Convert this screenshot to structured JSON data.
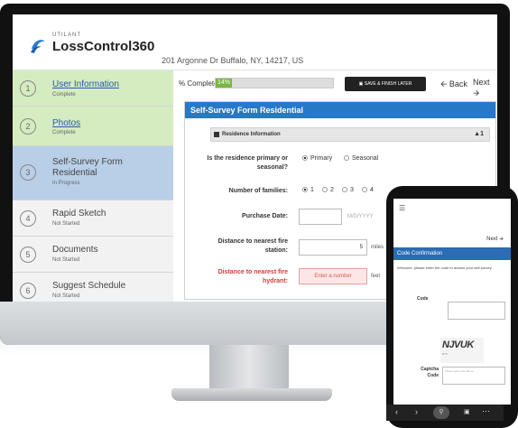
{
  "brand": {
    "small": "UTILANT",
    "name": "LossControl360",
    "accent": "#2b7bd6"
  },
  "address": "201 Argonne Dr Buffalo, NY, 14217, US",
  "steps": [
    {
      "num": "1",
      "label": "User Information",
      "status": "Complete",
      "state": "complete"
    },
    {
      "num": "2",
      "label": "Photos",
      "status": "Complete",
      "state": "complete"
    },
    {
      "num": "3",
      "label": "Self-Survey Form Residential",
      "status": "In Progress",
      "state": "active"
    },
    {
      "num": "4",
      "label": "Rapid Sketch",
      "status": "Not Started",
      "state": "pending"
    },
    {
      "num": "5",
      "label": "Documents",
      "status": "Not Started",
      "state": "pending"
    },
    {
      "num": "6",
      "label": "Suggest Schedule",
      "status": "Not Started",
      "state": "pending"
    }
  ],
  "toolbar": {
    "progress_label": "% Complete",
    "progress_value": "14%",
    "progress_percent": 14,
    "save_label": "SAVE & FINISH LATER",
    "back_label": "Back",
    "next_label": "Next"
  },
  "form": {
    "title": "Self-Survey Form Residential",
    "section": "Residence Information",
    "section_badge": "1",
    "q_primary": "Is the residence primary or seasonal?",
    "opt_primary": "Primary",
    "opt_seasonal": "Seasonal",
    "q_families": "Number of families:",
    "families_opts": [
      "1",
      "2",
      "3",
      "4"
    ],
    "q_purchase": "Purchase Date:",
    "purchase_placeholder": "M/D/YYYY",
    "q_fire_station": "Distance to nearest fire station:",
    "fire_station_value": "5",
    "fire_station_unit": "miles",
    "q_hydrant": "Distance to nearest fire hydrant:",
    "hydrant_placeholder": "Enter a number",
    "hydrant_unit": "feet"
  },
  "phone": {
    "next_label": "Next",
    "title": "Code Confirmation",
    "welcome": "Welcome, please enter the code to access your self-survey.",
    "code_label": "Code",
    "captcha_text": "NJVUK",
    "captcha_label": "Captcha Code",
    "captcha_placeholder": "Please type code above"
  },
  "colors": {
    "complete": "#d4ecc0",
    "active": "#b9cfe8",
    "pending": "#f2f2f2",
    "panel_blue": "#2878c8"
  }
}
